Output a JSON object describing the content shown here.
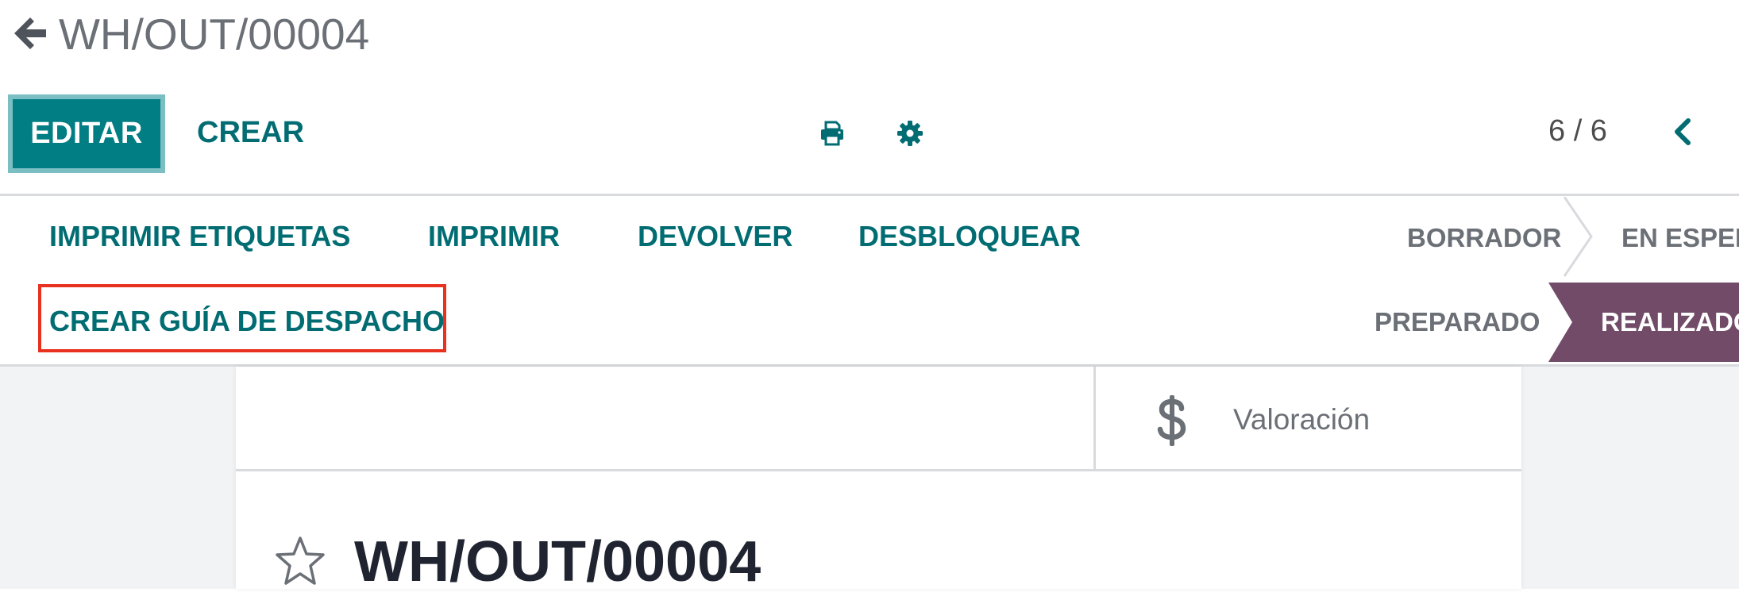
{
  "breadcrumb": {
    "back_icon": "arrow-left-icon",
    "title": "WH/OUT/00004"
  },
  "control_panel": {
    "edit_label": "EDITAR",
    "create_label": "CREAR",
    "print_icon": "print-icon",
    "action_icon": "gear-icon",
    "pager": {
      "value": "6 / 6",
      "prev_icon": "chevron-left-icon"
    }
  },
  "statusbar": {
    "buttons": [
      {
        "label": "IMPRIMIR ETIQUETAS"
      },
      {
        "label": "IMPRIMIR"
      },
      {
        "label": "DEVOLVER"
      },
      {
        "label": "DESBLOQUEAR"
      },
      {
        "label": "CREAR GUÍA DE DESPACHO",
        "highlighted": true
      }
    ],
    "stages": [
      {
        "label": "BORRADOR",
        "active": false
      },
      {
        "label": "EN ESPER",
        "active": false
      },
      {
        "label": "PREPARADO",
        "active": false
      },
      {
        "label": "REALIZADO",
        "active": true
      }
    ]
  },
  "sheet": {
    "smart_button": {
      "icon": "dollar-icon",
      "label": "Valoración"
    },
    "favorite_icon": "star-icon",
    "record_name": "WH/OUT/00004"
  },
  "colors": {
    "primary": "#017e84",
    "primary_text": "#016d73",
    "active_stage": "#714b67",
    "highlight": "#e8321f",
    "muted_text": "#6b6f76"
  }
}
